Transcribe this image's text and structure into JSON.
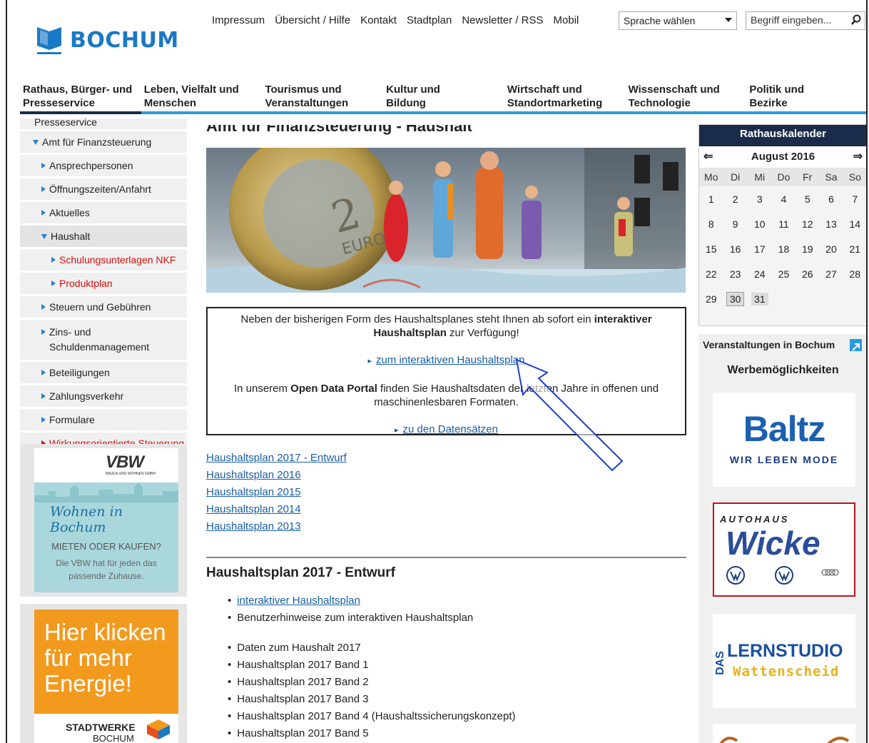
{
  "header": {
    "logo_text": "BOCHUM",
    "top_links": [
      "Impressum",
      "Übersicht / Hilfe",
      "Kontakt",
      "Stadtplan",
      "Newsletter / RSS",
      "Mobil"
    ],
    "language_select": "Sprache wählen",
    "search_placeholder": "Begriff eingeben..."
  },
  "main_nav": [
    {
      "line1": "Rathaus, Bürger- und",
      "line2": "Presseservice",
      "active": true
    },
    {
      "line1": "Leben, Vielfalt und",
      "line2": "Menschen"
    },
    {
      "line1": "Tourismus und",
      "line2": "Veranstaltungen"
    },
    {
      "line1": "Kultur und",
      "line2": "Bildung"
    },
    {
      "line1": "Wirtschaft und",
      "line2": "Standortmarketing"
    },
    {
      "line1": "Wissenschaft und",
      "line2": "Technologie"
    },
    {
      "line1": "Politik und",
      "line2": "Bezirke"
    }
  ],
  "sidebar": {
    "partial_top": "Presseservice",
    "items": [
      {
        "label": "Amt für Finanzsteuerung",
        "level": 1,
        "open": true
      },
      {
        "label": "Ansprechpersonen",
        "level": 2
      },
      {
        "label": "Öffnungszeiten/Anfahrt",
        "level": 2
      },
      {
        "label": "Aktuelles",
        "level": 2
      },
      {
        "label": "Haushalt",
        "level": 2,
        "open": true
      },
      {
        "label": "Schulungsunterlagen NKF",
        "level": 3
      },
      {
        "label": "Produktplan",
        "level": 3
      },
      {
        "label": "Steuern und Gebühren",
        "level": 2
      },
      {
        "label": "Zins- und Schuldenmanagement",
        "level": 2
      },
      {
        "label": "Beteiligungen",
        "level": 2
      },
      {
        "label": "Zahlungsverkehr",
        "level": 2
      },
      {
        "label": "Formulare",
        "level": 2
      },
      {
        "label": "Wirkungsorientierte Steuerung",
        "level": 2
      }
    ]
  },
  "ads_left": {
    "vbw_logo": "VBW",
    "vbw_sub": "BAUEN UND WOHNEN GMBH",
    "vbw_script": "Wohnen in Bochum",
    "vbw_head": "MIETEN ODER KAUFEN?",
    "vbw_text": "Die VBW hat für jeden das passende Zuhause.",
    "stw_text": "Hier klicken für mehr Energie!",
    "stw_brand1": "STADTWERKE",
    "stw_brand2": "BOCHUM"
  },
  "content": {
    "title": "Amt für Finanzsteuerung - Haushalt",
    "info_text_1": "Neben der bisherigen Form des Haushaltsplanes steht Ihnen ab sofort ein ",
    "info_bold_1": "interaktiver Haushaltsplan",
    "info_text_2": " zur Verfügung!",
    "info_link_1": "zum interaktiven Haushaltsplan",
    "info_text_3": "In unserem ",
    "info_bold_2": "Open Data Portal",
    "info_text_4": " finden Sie Haushaltsdaten der letzten Jahre in offenen und maschinenlesbaren Formaten.",
    "info_link_2": "zu den Datensätzen",
    "plan_links": [
      "Haushaltsplan 2017 - Entwurf",
      "Haushaltsplan 2016",
      "Haushaltsplan 2015",
      "Haushaltsplan 2014",
      "Haushaltsplan 2013"
    ],
    "section_title": "Haushaltsplan 2017 - Entwurf",
    "list_a": [
      {
        "text": "interaktiver Haushaltsplan",
        "link": true
      },
      {
        "text": "Benutzerhinweise zum interaktiven Haushaltsplan",
        "link": false
      }
    ],
    "list_b": [
      "Daten zum Haushalt 2017",
      "Haushaltsplan 2017 Band 1",
      "Haushaltsplan 2017 Band 2",
      "Haushaltsplan 2017 Band 3",
      "Haushaltsplan 2017 Band 4 (Haushaltssicherungskonzept)",
      "Haushaltsplan 2017 Band 5"
    ]
  },
  "calendar": {
    "title": "Rathauskalender",
    "month": "August 2016",
    "prev": "⇐",
    "next": "⇒",
    "weekdays": [
      "Mo",
      "Di",
      "Mi",
      "Do",
      "Fr",
      "Sa",
      "So"
    ],
    "weeks": [
      [
        "1",
        "2",
        "3",
        "4",
        "5",
        "6",
        "7"
      ],
      [
        "8",
        "9",
        "10",
        "11",
        "12",
        "13",
        "14"
      ],
      [
        "15",
        "16",
        "17",
        "18",
        "19",
        "20",
        "21"
      ],
      [
        "22",
        "23",
        "24",
        "25",
        "26",
        "27",
        "28"
      ],
      [
        "29",
        "30",
        "31",
        "",
        "",
        "",
        ""
      ]
    ],
    "today": "30",
    "highlight": "31"
  },
  "right": {
    "events_label": "Veranstaltungen in Bochum",
    "ads_label": "Werbemöglichkeiten",
    "ad1_brand": "Baltz",
    "ad1_sub": "WIR LEBEN MODE",
    "ad2_top": "AUTOHAUS",
    "ad2_brand": "Wicke",
    "ad3_das": "DAS",
    "ad3_brand": "LERNSTUDIO",
    "ad3_sub": "Wattenscheid"
  },
  "colors": {
    "accent": "#2a9be0",
    "navy": "#1b2c4a",
    "link": "#1a5fa5",
    "red": "#d01010"
  }
}
